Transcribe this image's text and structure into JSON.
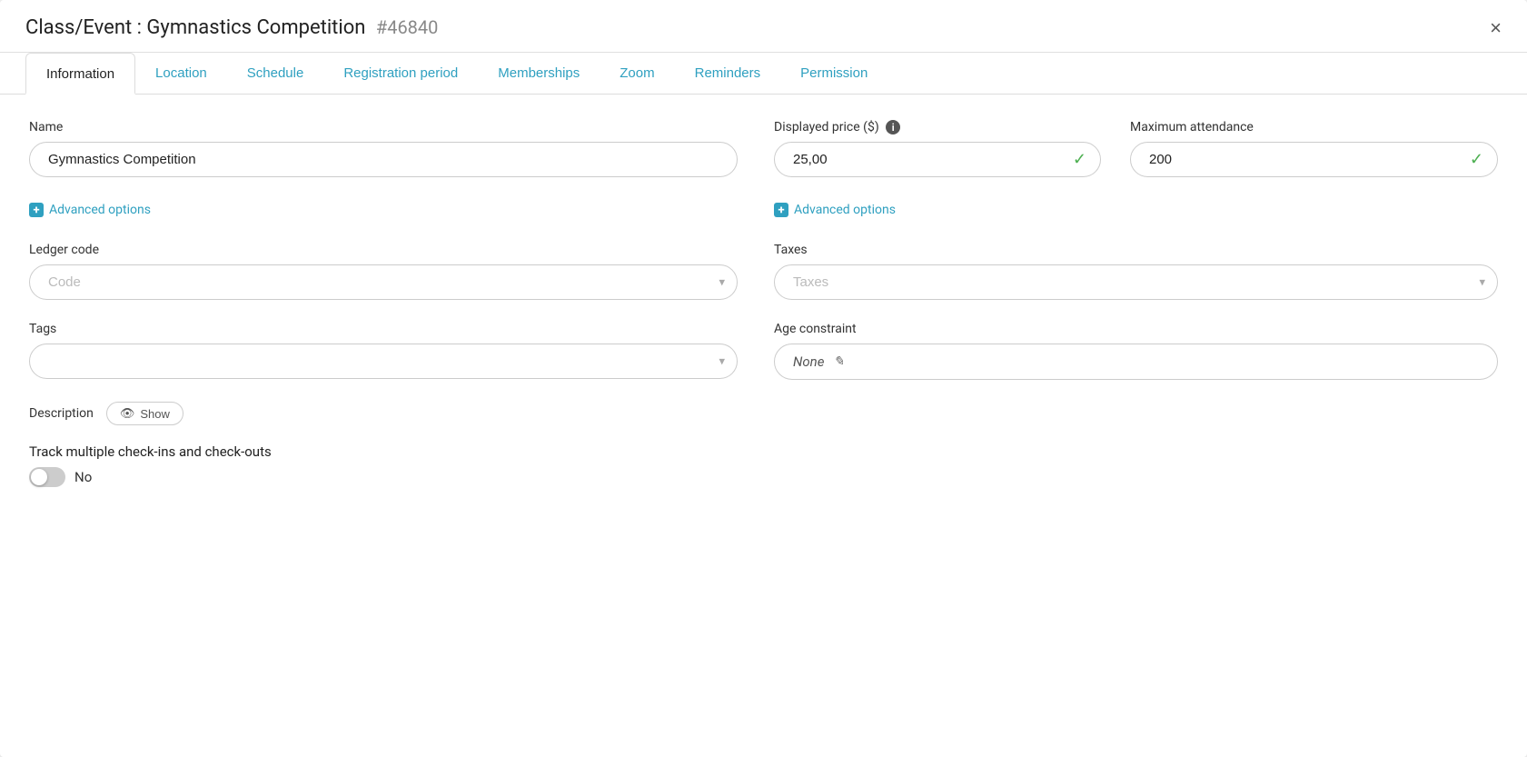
{
  "modal": {
    "title": "Class/Event : Gymnastics Competition",
    "event_id": "#46840"
  },
  "close_label": "×",
  "tabs": [
    {
      "label": "Information",
      "active": true
    },
    {
      "label": "Location",
      "active": false
    },
    {
      "label": "Schedule",
      "active": false
    },
    {
      "label": "Registration period",
      "active": false
    },
    {
      "label": "Memberships",
      "active": false
    },
    {
      "label": "Zoom",
      "active": false
    },
    {
      "label": "Reminders",
      "active": false
    },
    {
      "label": "Permission",
      "active": false
    }
  ],
  "fields": {
    "name_label": "Name",
    "name_value": "Gymnastics Competition",
    "name_placeholder": "",
    "advanced_options_left": "Advanced options",
    "advanced_options_right": "Advanced options",
    "displayed_price_label": "Displayed price ($)",
    "displayed_price_value": "25,00",
    "max_attendance_label": "Maximum attendance",
    "max_attendance_value": "200",
    "ledger_code_label": "Ledger code",
    "ledger_code_placeholder": "Code",
    "taxes_label": "Taxes",
    "taxes_placeholder": "Taxes",
    "tags_label": "Tags",
    "tags_placeholder": "",
    "age_constraint_label": "Age constraint",
    "age_constraint_value": "None",
    "description_label": "Description",
    "show_label": "Show",
    "track_label": "Track multiple check-ins and check-outs",
    "toggle_value": "No"
  }
}
